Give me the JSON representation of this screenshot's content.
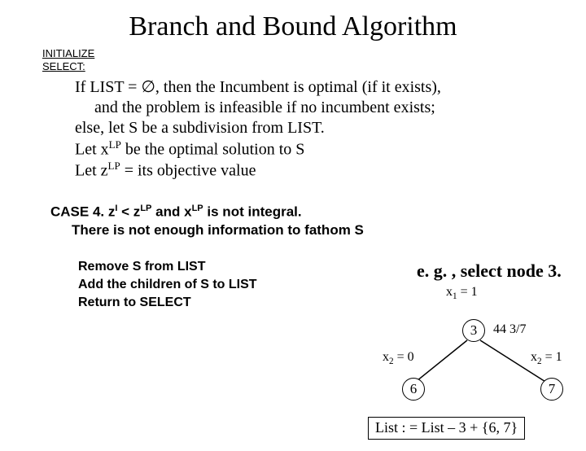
{
  "title": "Branch and Bound Algorithm",
  "labels": {
    "initialize": "INITIALIZE",
    "select": "SELECT:"
  },
  "select_body": {
    "line1_a": "If LIST = ",
    "line1_empty": "∅",
    "line1_b": ", then the Incumbent is optimal (if it exists),",
    "line2": "and the problem is infeasible if no incumbent exists;",
    "line3": "else, let S be a subdivision from LIST.",
    "line4_a": "Let x",
    "line4_sup": "LP",
    "line4_b": " be the optimal solution to S",
    "line5_a": "Let z",
    "line5_sup": "LP",
    "line5_b": " = its objective value"
  },
  "case4": {
    "prefix": "CASE 4.  z",
    "sup1": "I",
    "mid1": " < z",
    "sup2": "LP",
    "mid2": "  and x",
    "sup3": "LP",
    "tail": " is not integral.",
    "line2": "There is not enough information to fathom S"
  },
  "actions": {
    "a1": "Remove S from LIST",
    "a2": "Add the children of S to LIST",
    "a3": "Return to SELECT"
  },
  "example": {
    "heading": "e. g. , select node 3.",
    "top_label_a": "x",
    "top_label_sub": "1",
    "top_label_b": " = 1",
    "node_root": "3",
    "root_value": "44 3/7",
    "left_label_a": "x",
    "left_label_sub": "2",
    "left_label_b": " = 0",
    "right_label_a": "x",
    "right_label_sub": "2",
    "right_label_b": " = 1",
    "node_left": "6",
    "node_right": "7",
    "list_update": "List : = List – 3 + {6, 7}"
  }
}
